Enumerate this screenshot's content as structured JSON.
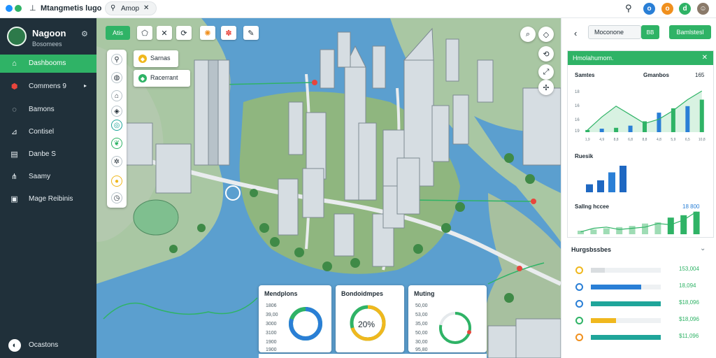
{
  "topbar": {
    "app_title": "Mtangmetis lugo",
    "tab_label": "Amop",
    "colors": {
      "dot1": "#1e90ff",
      "dot2": "#2fb366",
      "ico1": "#2a7fd6",
      "ico2": "#f0901e",
      "ico3": "#2fb366"
    }
  },
  "sidebar": {
    "title": "Nagoon",
    "subtitle": "Bosomees",
    "items": [
      {
        "label": "Dashbooms",
        "icon": "home-icon",
        "active": true
      },
      {
        "label": "Commens 9",
        "icon": "layers-icon",
        "active": false
      },
      {
        "label": "Bamons",
        "icon": "leaf-icon",
        "active": false
      },
      {
        "label": "Contisel",
        "icon": "analytics-icon",
        "active": false
      },
      {
        "label": "Danbe S",
        "icon": "table-icon",
        "active": false
      },
      {
        "label": "Saamy",
        "icon": "network-icon",
        "active": false
      },
      {
        "label": "Mage Reibinis",
        "icon": "report-icon",
        "active": false
      }
    ],
    "settings_label": "Ocastons"
  },
  "map": {
    "toolbar_label": "Atis",
    "pills": [
      {
        "label": "Sarnas",
        "icon": "tag-icon"
      },
      {
        "label": "Racerrant",
        "icon": "marker-icon"
      }
    ],
    "cards": [
      {
        "title": "Mendplons",
        "rows": [
          "1806",
          "39,00",
          "3000",
          "3100",
          "1900",
          "1900"
        ],
        "donut_value": 0.8
      },
      {
        "title": "Bondoidmpes",
        "center_label": "20%",
        "donut_value": 0.7
      },
      {
        "title": "Muting",
        "rows": [
          "50,00",
          "53,00",
          "35,00",
          "50,00",
          "30,00",
          "95,80"
        ],
        "gauge_value": 0.78
      }
    ]
  },
  "panel": {
    "search_value": "Moconone",
    "grid_label": "BB",
    "export_label": "Bamlstesl",
    "analysis_title": "Hmolahumom.",
    "chart1": {
      "title": "Samtes",
      "subtitle": "Gmanbos",
      "right_label": "165",
      "y_ticks": [
        "18",
        "16",
        "16",
        "19"
      ],
      "x_ticks": [
        "1,9",
        "4,9",
        "8,8",
        "6,8",
        "8,8",
        "4,8",
        "5,9",
        "6,5",
        "10,8"
      ],
      "bars": [
        0.05,
        0.08,
        0.1,
        0.15,
        0.25,
        0.45,
        0.55,
        0.6,
        0.75
      ],
      "line": [
        0.05,
        0.35,
        0.6,
        0.4,
        0.2,
        0.3,
        0.5,
        0.75,
        0.95
      ]
    },
    "chart2": {
      "title": "Ruesik",
      "bars": [
        0.3,
        0.45,
        0.75,
        1.0
      ]
    },
    "chart3": {
      "title": "Sallng hccee",
      "value": "18 800",
      "bars": [
        0.15,
        0.2,
        0.25,
        0.3,
        0.35,
        0.45,
        0.5,
        0.7,
        0.8,
        0.95
      ],
      "line": [
        0.1,
        0.25,
        0.3,
        0.2,
        0.25,
        0.3,
        0.45,
        0.4,
        0.6,
        0.95
      ]
    },
    "list_title": "Hurgsbssbes",
    "list": [
      {
        "ring": "#f0b81e",
        "fill": "#d9dde0",
        "ratio": 0.2,
        "value": "153,004"
      },
      {
        "ring": "#2a7fd6",
        "fill": "#2a7fd6",
        "ratio": 0.72,
        "value": "18,094"
      },
      {
        "ring": "#2a7fd6",
        "fill": "#1fa59a",
        "ratio": 1.0,
        "value": "$18,096"
      },
      {
        "ring": "#2fb366",
        "fill": "#f0b81e",
        "ratio": 0.36,
        "value": "$18,096"
      },
      {
        "ring": "#f0901e",
        "fill": "#1fa59a",
        "ratio": 1.0,
        "value": "$11,096"
      }
    ]
  }
}
